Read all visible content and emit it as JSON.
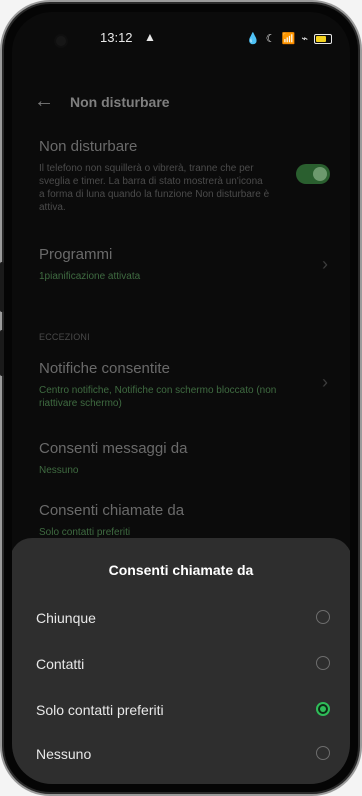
{
  "statusbar": {
    "time": "13:12",
    "warning_icon": "warning-triangle-icon",
    "right_icons": [
      "drop-icon",
      "moon-icon",
      "wifi-icon",
      "signal-icon",
      "battery-icon"
    ]
  },
  "appbar": {
    "title": "Non disturbare"
  },
  "settings": {
    "dnd_title": "Non disturbare",
    "dnd_desc": "Il telefono non squillerà o vibrerà, tranne che per sveglia e timer. La barra di stato mostrerà un'icona a forma di luna quando la funzione Non disturbare è attiva.",
    "dnd_enabled": true,
    "programmi_title": "Programmi",
    "programmi_sub": "1pianificazione attivata",
    "eccezioni_label": "ECCEZIONI",
    "notifiche_title": "Notifiche consentite",
    "notifiche_sub": "Centro notifiche, Notifiche con schermo bloccato (non riattivare schermo)",
    "messaggi_title": "Consenti messaggi da",
    "messaggi_sub": "Nessuno",
    "chiamate_title": "Consenti chiamate da",
    "chiamate_sub": "Solo contatti preferiti"
  },
  "sheet": {
    "title": "Consenti chiamate da",
    "options": [
      {
        "label": "Chiunque",
        "selected": false
      },
      {
        "label": "Contatti",
        "selected": false
      },
      {
        "label": "Solo contatti preferiti",
        "selected": true
      },
      {
        "label": "Nessuno",
        "selected": false
      }
    ]
  },
  "colors": {
    "accent": "#2fbd59",
    "sheet": "#2e2e2e"
  }
}
